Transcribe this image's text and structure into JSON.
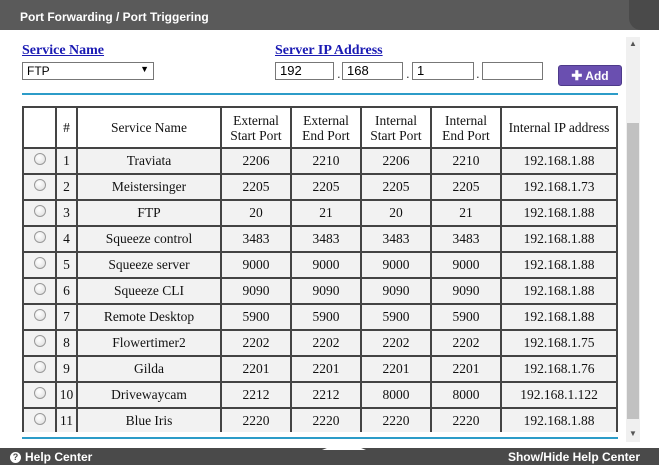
{
  "window": {
    "title": "Port Forwarding / Port Triggering"
  },
  "service_name": {
    "label": "Service Name",
    "selected": "FTP"
  },
  "server_ip": {
    "label": "Server IP Address",
    "octets": [
      "192",
      "168",
      "1",
      ""
    ],
    "separator": "."
  },
  "add_button": {
    "label": "Add",
    "icon": "plus-icon"
  },
  "table": {
    "headers": {
      "select": "",
      "num": "#",
      "service": "Service Name",
      "ext_start_1": "External",
      "ext_start_2": "Start Port",
      "ext_end_1": "External",
      "ext_end_2": "End Port",
      "int_start_1": "Internal",
      "int_start_2": "Start Port",
      "int_end_1": "Internal",
      "int_end_2": "End Port",
      "ip": "Internal IP address"
    },
    "rows": [
      {
        "num": "1",
        "service": "Traviata",
        "ext_start": "2206",
        "ext_end": "2210",
        "int_start": "2206",
        "int_end": "2210",
        "ip": "192.168.1.88"
      },
      {
        "num": "2",
        "service": "Meistersinger",
        "ext_start": "2205",
        "ext_end": "2205",
        "int_start": "2205",
        "int_end": "2205",
        "ip": "192.168.1.73"
      },
      {
        "num": "3",
        "service": "FTP",
        "ext_start": "20",
        "ext_end": "21",
        "int_start": "20",
        "int_end": "21",
        "ip": "192.168.1.88"
      },
      {
        "num": "4",
        "service": "Squeeze control",
        "ext_start": "3483",
        "ext_end": "3483",
        "int_start": "3483",
        "int_end": "3483",
        "ip": "192.168.1.88"
      },
      {
        "num": "5",
        "service": "Squeeze server",
        "ext_start": "9000",
        "ext_end": "9000",
        "int_start": "9000",
        "int_end": "9000",
        "ip": "192.168.1.88"
      },
      {
        "num": "6",
        "service": "Squeeze CLI",
        "ext_start": "9090",
        "ext_end": "9090",
        "int_start": "9090",
        "int_end": "9090",
        "ip": "192.168.1.88"
      },
      {
        "num": "7",
        "service": "Remote Desktop",
        "ext_start": "5900",
        "ext_end": "5900",
        "int_start": "5900",
        "int_end": "5900",
        "ip": "192.168.1.88"
      },
      {
        "num": "8",
        "service": "Flowertimer2",
        "ext_start": "2202",
        "ext_end": "2202",
        "int_start": "2202",
        "int_end": "2202",
        "ip": "192.168.1.75"
      },
      {
        "num": "9",
        "service": "Gilda",
        "ext_start": "2201",
        "ext_end": "2201",
        "int_start": "2201",
        "int_end": "2201",
        "ip": "192.168.1.76"
      },
      {
        "num": "10",
        "service": "Drivewaycam",
        "ext_start": "2212",
        "ext_end": "2212",
        "int_start": "8000",
        "int_end": "8000",
        "ip": "192.168.1.122"
      },
      {
        "num": "11",
        "service": "Blue Iris",
        "ext_start": "2220",
        "ext_end": "2220",
        "int_start": "2220",
        "int_end": "2220",
        "ip": "192.168.1.88"
      }
    ]
  },
  "footer": {
    "help_center": "Help Center",
    "show_hide": "Show/Hide Help Center"
  },
  "colors": {
    "accent_rule": "#2c9cc8",
    "link": "#1a1ab3",
    "add_button": "#6a4fb0",
    "chrome": "#4a4a4a"
  }
}
